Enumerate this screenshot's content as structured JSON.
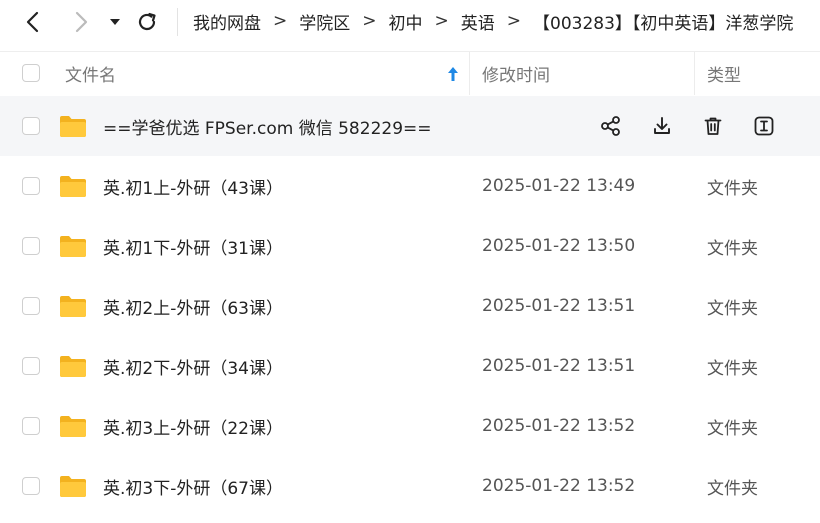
{
  "breadcrumb": {
    "items": [
      "我的网盘",
      "学院区",
      "初中",
      "英语",
      "【003283】【初中英语】洋葱学院"
    ],
    "separator": ">"
  },
  "columns": {
    "name": "文件名",
    "modified": "修改时间",
    "type": "类型"
  },
  "rows": [
    {
      "name": "==学爸优选 FPSer.com 微信 582229==",
      "modified": "",
      "type": "",
      "hovered": true
    },
    {
      "name": "英.初1上-外研（43课）",
      "modified": "2025-01-22 13:49",
      "type": "文件夹"
    },
    {
      "name": "英.初1下-外研（31课）",
      "modified": "2025-01-22 13:50",
      "type": "文件夹"
    },
    {
      "name": "英.初2上-外研（63课）",
      "modified": "2025-01-22 13:51",
      "type": "文件夹"
    },
    {
      "name": "英.初2下-外研（34课）",
      "modified": "2025-01-22 13:51",
      "type": "文件夹"
    },
    {
      "name": "英.初3上-外研（22课）",
      "modified": "2025-01-22 13:52",
      "type": "文件夹"
    },
    {
      "name": "英.初3下-外研（67课）",
      "modified": "2025-01-22 13:52",
      "type": "文件夹"
    }
  ],
  "row_actions": [
    "share-icon",
    "download-icon",
    "delete-icon",
    "rename-icon"
  ],
  "colors": {
    "accent": "#1e88e5",
    "folder": "#ffc93c",
    "folder_back": "#f3b21f",
    "hover_row": "#f5f6f8"
  }
}
